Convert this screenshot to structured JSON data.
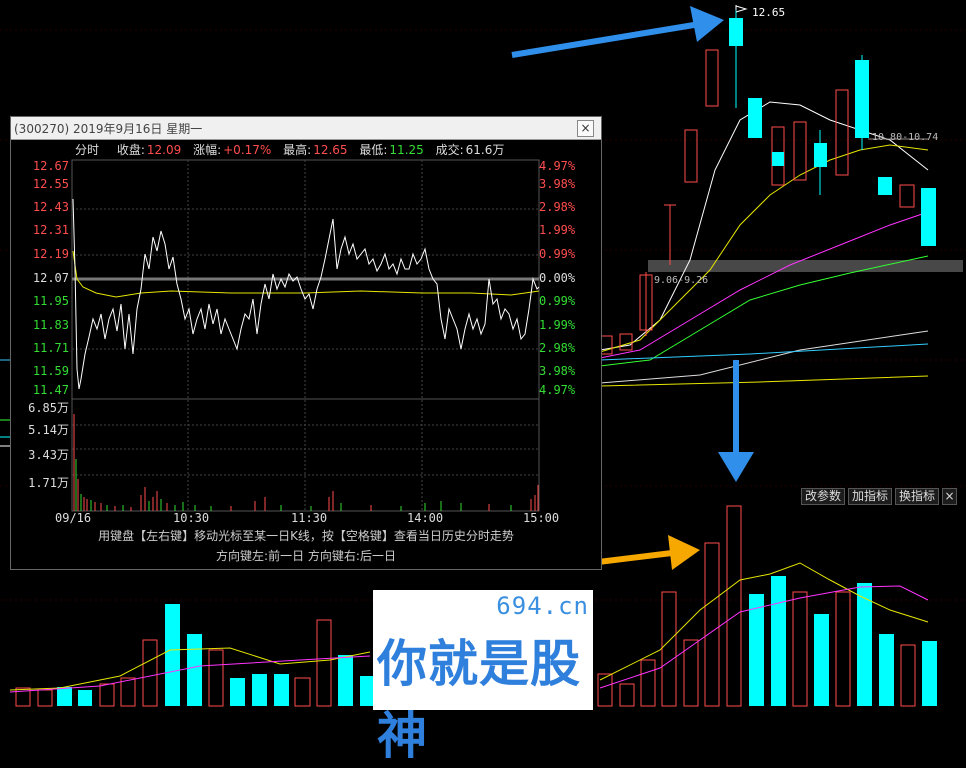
{
  "main_chart": {
    "peak_price_label": "12.65",
    "range_label_upper": "10.80-10.74",
    "range_label_lower": "9.06-9.26",
    "toolbar": {
      "modify_params": "改参数",
      "add_indicator": "加指标",
      "replace_indicator": "换指标",
      "close": "×"
    }
  },
  "popup": {
    "title": "(300270) 2019年9月16日 星期一",
    "close_label": "×",
    "info": {
      "mode": "分时",
      "close_label": "收盘:",
      "close_value": "12.09",
      "change_label": "涨幅:",
      "change_value": "+0.17%",
      "high_label": "最高:",
      "high_value": "12.65",
      "low_label": "最低:",
      "low_value": "11.25",
      "volume_label": "成交:",
      "volume_value": "61.6万"
    },
    "price_axis_left": [
      "12.67",
      "12.55",
      "12.43",
      "12.31",
      "12.19",
      "12.07",
      "11.95",
      "11.83",
      "11.71",
      "11.59",
      "11.47"
    ],
    "pct_axis_right": [
      "4.97%",
      "3.98%",
      "2.98%",
      "1.99%",
      "0.99%",
      "0.00%",
      "0.99%",
      "1.99%",
      "2.98%",
      "3.98%",
      "4.97%"
    ],
    "volume_axis": [
      "6.85万",
      "5.14万",
      "3.43万",
      "1.71万"
    ],
    "time_axis": [
      "09/16",
      "10:30",
      "11:30",
      "14:00",
      "15:00"
    ],
    "hint_line1": "用键盘【左右键】移动光标至某一日K线，按【空格键】查看当日历史分时走势",
    "hint_line2": "方向键左:前一日   方向键右:后一日",
    "colors": {
      "up": "#ff4d4d",
      "down": "#33dd33",
      "price_line": "#ffffff",
      "avg_line": "#e6e600"
    }
  },
  "watermark": {
    "url": "694.cn",
    "text": "你就是股神"
  }
}
